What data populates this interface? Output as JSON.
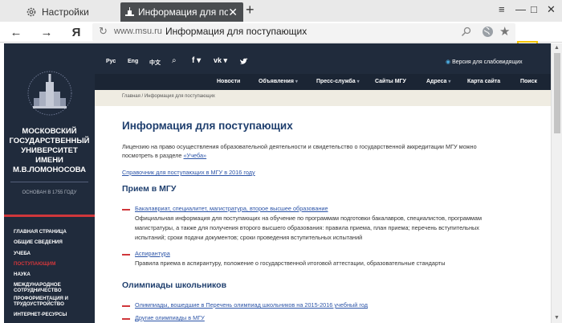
{
  "browser": {
    "tabs": [
      {
        "label": "Настройки"
      },
      {
        "label": "Информация для поступающих"
      }
    ],
    "new_tab": "+",
    "address": {
      "host": "www.msu.ru",
      "title": "Информация для поступающих"
    },
    "logo_letter": "Я",
    "window_controls": [
      "≡",
      "—",
      "□",
      "✕"
    ],
    "accent_highlight": "#f5c400"
  },
  "site": {
    "university_name": [
      "МОСКОВСКИЙ",
      "ГОСУДАРСТВЕННЫЙ",
      "УНИВЕРСИТЕТ",
      "ИМЕНИ",
      "М.В.ЛОМОНОСОВА"
    ],
    "founded": "ОСНОВАН В 1755 ГОДУ",
    "languages": [
      "Рус",
      "Eng",
      "中文"
    ],
    "low_vision": "Версия для слабовидящих",
    "nav": [
      {
        "label": "Новости",
        "caret": false
      },
      {
        "label": "Объявления",
        "caret": true
      },
      {
        "label": "Пресс-служба",
        "caret": true
      },
      {
        "label": "Сайты МГУ",
        "caret": false
      },
      {
        "label": "Адреса",
        "caret": true
      },
      {
        "label": "Карта сайта",
        "caret": false
      },
      {
        "label": "Поиск",
        "caret": false
      }
    ],
    "menu": [
      {
        "label": "ГЛАВНАЯ СТРАНИЦА",
        "active": false
      },
      {
        "label": "ОБЩИЕ СВЕДЕНИЯ",
        "active": false
      },
      {
        "label": "УЧЕБА",
        "active": false
      },
      {
        "label": "ПОСТУПАЮЩИМ",
        "active": true
      },
      {
        "label": "НАУКА",
        "active": false
      },
      {
        "label": "МЕЖДУНАРОДНОЕ СОТРУДНИЧЕСТВО",
        "active": false
      },
      {
        "label": "ПРОФОРИЕНТАЦИЯ И ТРУДОУСТРОЙСТВО",
        "active": false
      },
      {
        "label": "ИНТЕРНЕТ-РЕСУРСЫ",
        "active": false
      }
    ],
    "breadcrumb": "Главная / Информация для поступающих",
    "colors": {
      "dark_navy": "#202b3c",
      "title_blue": "#1f3f6e",
      "link": "#2d55a8",
      "accent_red": "#d0373b"
    }
  },
  "content": {
    "title": "Информация для поступающих",
    "intro_line1": "Лицензию на право осуществления образовательной деятельности и свидетельство о государственной аккредитации МГУ можно",
    "intro_line2_text": "посмотреть в разделе ",
    "intro_line2_link": "«Учеба»",
    "handbook_link": "Справочник для поступающих в МГУ в 2016 году",
    "section1_title": "Прием в МГУ",
    "item1_link": "Бакалавриат, специалитет, магистратура, второе высшее образование",
    "item1_desc": [
      "Официальная информация для поступающих на обучение по программам подготовки бакалавров, специалистов, программам",
      "магистратуры, а также для получения второго высшего образования: правила приема, план приема; перечень вступительных",
      "испытаний; сроки подачи документов; сроки проведения вступительных испытаний"
    ],
    "item2_link": "Аспирантура",
    "item2_desc": "Правила приема в аспирантуру, положение о государственной итоговой аттестации, образовательные стандарты",
    "section2_title": "Олимпиады школьников",
    "item3_link": "Олимпиады, вошедшие в Перечень олимпиад школьников на 2015-2016 учебный год",
    "item4_link": "Другие олимпиады в МГУ"
  }
}
